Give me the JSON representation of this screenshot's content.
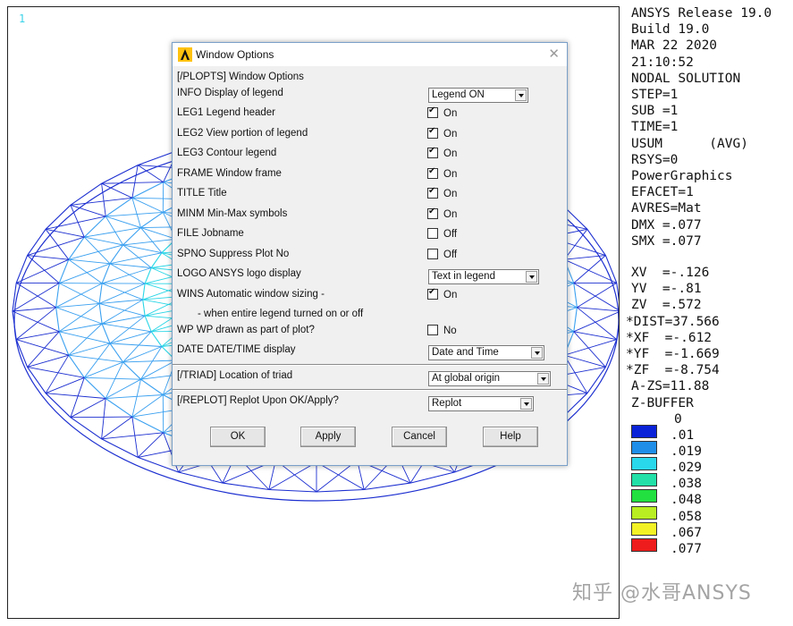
{
  "graphics": {
    "window_number": "1",
    "colors": {
      "mesh_blue": "#1c2fd0",
      "mesh_cyan": "#29d6e6",
      "mesh_light_blue": "#3aa0f0",
      "mesh_green": "#3ad864",
      "mesh_yellow_green": "#a8e830"
    }
  },
  "legend": {
    "header_lines": [
      "ANSYS Release 19.0",
      "Build 19.0",
      "MAR 22 2020",
      "21:10:52",
      "NODAL SOLUTION",
      "STEP=1",
      "SUB =1",
      "TIME=1",
      "USUM      (AVG)",
      "RSYS=0",
      "PowerGraphics",
      "EFACET=1",
      "AVRES=Mat",
      "DMX =.077",
      "SMX =.077"
    ],
    "view_lines": [
      "XV  =-.126",
      "YV  =-.81",
      "ZV  =.572",
      "*DIST=37.566",
      "*XF  =-.612",
      "*YF  =-1.669",
      "*ZF  =-8.754",
      "A-ZS=11.88",
      "Z-BUFFER"
    ],
    "contour_min": "0",
    "contours": [
      {
        "value": ".01",
        "color": "#0a22d8"
      },
      {
        "value": ".019",
        "color": "#1e8ee8"
      },
      {
        "value": ".029",
        "color": "#2ad8ec"
      },
      {
        "value": ".038",
        "color": "#22e0a8"
      },
      {
        "value": ".048",
        "color": "#22e040"
      },
      {
        "value": ".058",
        "color": "#b8ee22"
      },
      {
        "value": ".067",
        "color": "#f2f226"
      },
      {
        "value": ".077",
        "color": "#ee1c1c"
      }
    ]
  },
  "watermark": "知乎 @水哥ANSYS",
  "dialog": {
    "title": "Window Options",
    "header": "[/PLOPTS]  Window Options",
    "rows": [
      {
        "code": "INFO",
        "label": "Display of legend"
      },
      {
        "code": "LEG1",
        "label": "Legend header",
        "checked": true,
        "state": "On"
      },
      {
        "code": "LEG2",
        "label": "View portion of legend",
        "checked": true,
        "state": "On"
      },
      {
        "code": "LEG3",
        "label": "Contour legend",
        "checked": true,
        "state": "On"
      },
      {
        "code": "FRAME",
        "label": "Window frame",
        "checked": true,
        "state": "On"
      },
      {
        "code": "TITLE",
        "label": "Title",
        "checked": true,
        "state": "On"
      },
      {
        "code": "MINM",
        "label": "Min-Max symbols",
        "checked": true,
        "state": "On"
      },
      {
        "code": "FILE",
        "label": "Jobname",
        "checked": false,
        "state": "Off"
      },
      {
        "code": "SPNO",
        "label": "Suppress Plot No",
        "checked": false,
        "state": "Off"
      },
      {
        "code": "LOGO",
        "label": "ANSYS logo display"
      },
      {
        "code": "WINS",
        "label": "Automatic window sizing -",
        "checked": true,
        "state": "On"
      },
      {
        "code": "",
        "label": "- when entire legend turned on or off"
      },
      {
        "code": "WP",
        "label": "WP drawn as part of plot?",
        "checked": false,
        "state": "No"
      },
      {
        "code": "DATE",
        "label": "DATE/TIME display"
      }
    ],
    "info_select": "Legend ON",
    "logo_select": "Text in legend",
    "date_select": "Date and Time",
    "triad_label": "[/TRIAD]  Location of triad",
    "triad_select": "At global origin",
    "replot_label": "[/REPLOT]  Replot Upon OK/Apply?",
    "replot_select": "Replot",
    "buttons": {
      "ok": "OK",
      "apply": "Apply",
      "cancel": "Cancel",
      "help": "Help"
    }
  }
}
